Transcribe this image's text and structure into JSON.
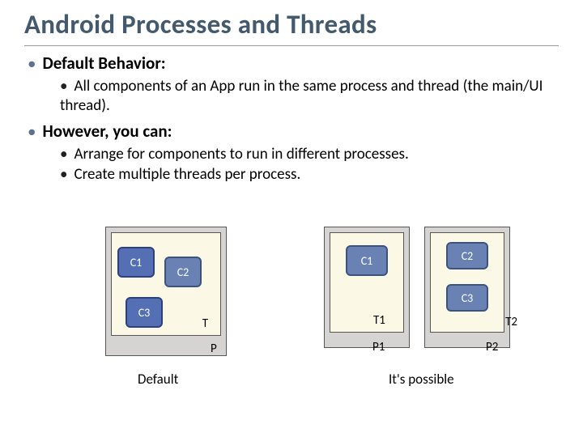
{
  "title": "Android Processes and Threads",
  "bullets": {
    "b1a": "Default Behavior:",
    "b1a_sub": "All components of an App run in the same process and thread (the main/UI thread).",
    "b1b": "However, you can:",
    "b1b_sub1": "Arrange for components to run in different processes.",
    "b1b_sub2": "Create multiple threads per process."
  },
  "diagram": {
    "left": {
      "c1": "C1",
      "c2": "C2",
      "c3": "C3",
      "t": "T",
      "p": "P",
      "caption": "Default"
    },
    "right": {
      "c1": "C1",
      "c2": "C2",
      "c3": "C3",
      "t1": "T1",
      "t2": "T2",
      "p1": "P1",
      "p2": "P2",
      "caption": "It's possible"
    }
  }
}
